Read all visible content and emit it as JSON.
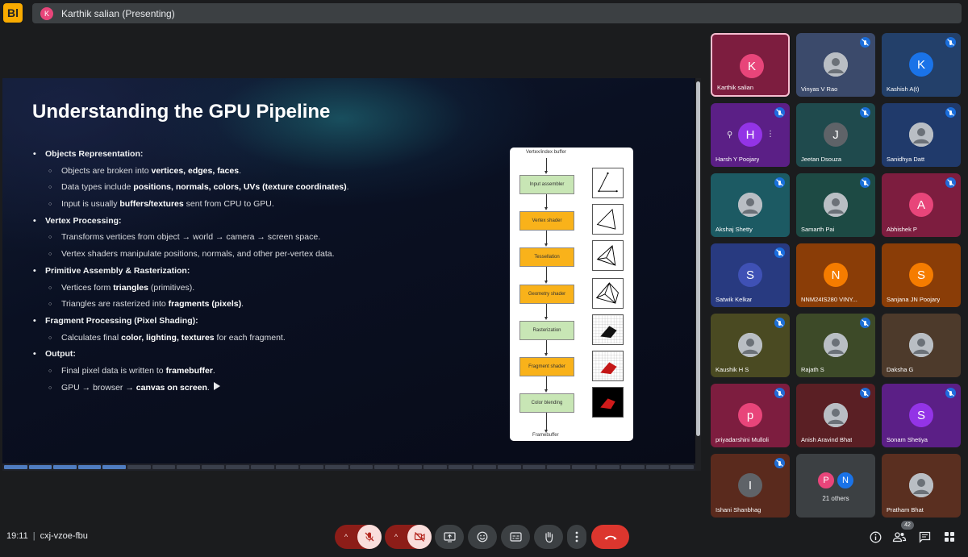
{
  "header": {
    "app_logo": "meet-logo-icon",
    "presenter_initial": "K",
    "presenter_label": "Karthik salian (Presenting)"
  },
  "slide": {
    "title": "Understanding the GPU Pipeline",
    "bullets": [
      {
        "level": 1,
        "parts": [
          {
            "t": "Objects Representation:"
          }
        ]
      },
      {
        "level": 2,
        "parts": [
          {
            "t": "Objects are broken into "
          },
          {
            "t": "vertices, edges, faces",
            "b": true
          },
          {
            "t": "."
          }
        ]
      },
      {
        "level": 2,
        "parts": [
          {
            "t": "Data types include "
          },
          {
            "t": "positions, normals, colors, UVs (texture coordinates)",
            "b": true
          },
          {
            "t": "."
          }
        ]
      },
      {
        "level": 2,
        "parts": [
          {
            "t": "Input is usually "
          },
          {
            "t": "buffers/textures",
            "b": true
          },
          {
            "t": " sent from CPU to GPU."
          }
        ]
      },
      {
        "level": 1,
        "parts": [
          {
            "t": "Vertex Processing:"
          }
        ]
      },
      {
        "level": 2,
        "parts": [
          {
            "t": "Transforms vertices from object → world → camera → screen space."
          }
        ]
      },
      {
        "level": 2,
        "parts": [
          {
            "t": "Vertex shaders manipulate positions, normals, and other per-vertex data."
          }
        ]
      },
      {
        "level": 1,
        "parts": [
          {
            "t": "Primitive Assembly & Rasterization:"
          }
        ]
      },
      {
        "level": 2,
        "parts": [
          {
            "t": "Vertices form "
          },
          {
            "t": "triangles",
            "b": true
          },
          {
            "t": " (primitives)."
          }
        ]
      },
      {
        "level": 2,
        "parts": [
          {
            "t": "Triangles are rasterized into "
          },
          {
            "t": "fragments (pixels)",
            "b": true
          },
          {
            "t": "."
          }
        ]
      },
      {
        "level": 1,
        "parts": [
          {
            "t": "Fragment Processing (Pixel Shading):"
          }
        ]
      },
      {
        "level": 2,
        "parts": [
          {
            "t": "Calculates final "
          },
          {
            "t": "color, lighting, textures",
            "b": true
          },
          {
            "t": " for each fragment."
          }
        ]
      },
      {
        "level": 1,
        "parts": [
          {
            "t": "Output:"
          }
        ]
      },
      {
        "level": 2,
        "parts": [
          {
            "t": "Final pixel data is written to "
          },
          {
            "t": "framebuffer",
            "b": true
          },
          {
            "t": "."
          }
        ]
      },
      {
        "level": 2,
        "parts": [
          {
            "t": "GPU → browser → "
          },
          {
            "t": "canvas on screen",
            "b": true
          },
          {
            "t": "."
          }
        ]
      }
    ],
    "diagram": {
      "top_label": "Vertex/index buffer",
      "bottom_label": "Framebuffer",
      "stages": [
        {
          "label": "Input assembler",
          "color": "green"
        },
        {
          "label": "Vertex shader",
          "color": "orange"
        },
        {
          "label": "Tessellation",
          "color": "orange"
        },
        {
          "label": "Geometry shader",
          "color": "orange"
        },
        {
          "label": "Rasterization",
          "color": "green"
        },
        {
          "label": "Fragment shader",
          "color": "orange"
        },
        {
          "label": "Color blending",
          "color": "green"
        }
      ]
    },
    "progress_segments_total": 28,
    "progress_segments_done": 5
  },
  "participants": [
    {
      "name": "Karthik salian",
      "initial": "K",
      "avatar_color": "#e8457a",
      "tile_color": "#7d1d3f",
      "presenting": true,
      "muted": false
    },
    {
      "name": "Vinyas V Rao",
      "photo": true,
      "tile_color": "#3b4a6b",
      "muted": true
    },
    {
      "name": "Kashish A(t)",
      "initial": "K",
      "avatar_color": "#1a73e8",
      "tile_color": "#23406a",
      "muted": true
    },
    {
      "name": "Harsh Y Poojary",
      "initial": "H",
      "avatar_color": "#9334e6",
      "tile_color": "#5b1f86",
      "muted": true,
      "hover": true
    },
    {
      "name": "Jeetan Dsouza",
      "initial": "J",
      "avatar_color": "#5f6368",
      "tile_color": "#1f4a4d",
      "muted": true
    },
    {
      "name": "Sanidhya Datt",
      "photo": true,
      "tile_color": "#203a6b",
      "muted": true
    },
    {
      "name": "Akshaj Shetty",
      "photo": true,
      "tile_color": "#1c5a63",
      "muted": true
    },
    {
      "name": "Samarth Pai",
      "photo": true,
      "tile_color": "#1d4a44",
      "muted": true
    },
    {
      "name": "Abhishek P",
      "initial": "A",
      "avatar_color": "#e8457a",
      "tile_color": "#7d1d3f",
      "muted": true
    },
    {
      "name": "Satwik Kelkar",
      "initial": "S",
      "avatar_color": "#3f51b5",
      "tile_color": "#283a80",
      "muted": true
    },
    {
      "name": "NNM24IS280 VINY...",
      "initial": "N",
      "avatar_color": "#f57c00",
      "tile_color": "#8a3d07",
      "muted": false
    },
    {
      "name": "Sanjana JN Poojary",
      "initial": "S",
      "avatar_color": "#f57c00",
      "tile_color": "#8a3d07",
      "muted": false
    },
    {
      "name": "Kaushik H S",
      "photo": true,
      "tile_color": "#4a4a22",
      "muted": true
    },
    {
      "name": "Rajath S",
      "photo": true,
      "tile_color": "#3d4a28",
      "muted": true
    },
    {
      "name": "Daksha G",
      "photo": true,
      "tile_color": "#4d3a2b",
      "muted": false
    },
    {
      "name": "priyadarshini Mulloli",
      "initial": "p",
      "avatar_color": "#e8457a",
      "tile_color": "#7d1d3f",
      "muted": true
    },
    {
      "name": "Anish Aravind Bhat",
      "photo": true,
      "tile_color": "#5a1f24",
      "muted": true
    },
    {
      "name": "Sonam Shetiya",
      "initial": "S",
      "avatar_color": "#9334e6",
      "tile_color": "#5b1f86",
      "muted": true
    },
    {
      "name": "Ishani Shanbhag",
      "initial": "I",
      "avatar_color": "#5f6368",
      "tile_color": "#5a2a1d",
      "muted": true
    },
    {
      "name": "21 others",
      "others": true,
      "initials": [
        "P",
        "N"
      ],
      "tile_color": "#3c4043"
    },
    {
      "name": "Pratham Bhat",
      "photo": true,
      "tile_color": "#5a2f20",
      "muted": false
    }
  ],
  "footer": {
    "time": "19:11",
    "meeting_code": "cxj-vzoe-fbu",
    "participant_count": "42",
    "icons": {
      "mic": "mic-off-icon",
      "camera": "camera-off-icon",
      "present": "present-screen-icon",
      "emoji": "emoji-icon",
      "captions": "captions-icon",
      "hand": "raise-hand-icon",
      "more": "more-options-icon",
      "hangup": "hang-up-icon",
      "info": "info-icon",
      "people": "people-icon",
      "chat": "chat-icon",
      "activities": "activities-icon"
    }
  }
}
